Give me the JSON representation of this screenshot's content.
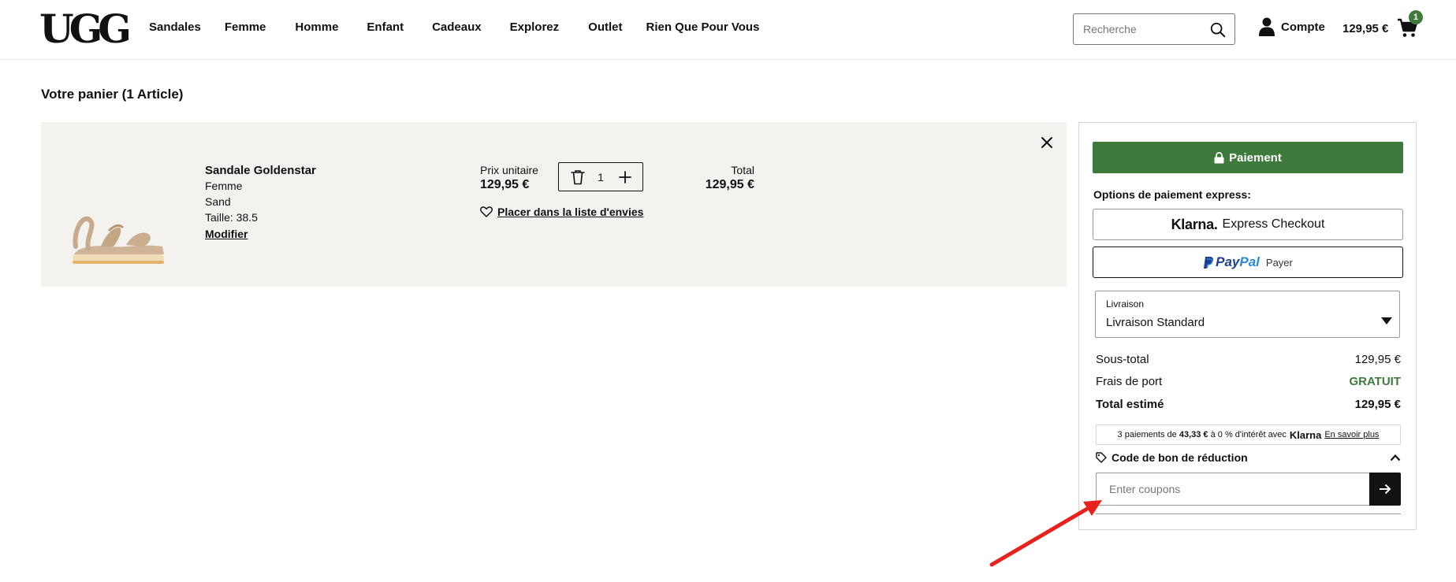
{
  "header": {
    "logo": "UGG",
    "nav": [
      "Sandales",
      "Femme",
      "Homme",
      "Enfant",
      "Cadeaux",
      "Explorez",
      "Outlet",
      "Rien Que Pour Vous"
    ],
    "search_placeholder": "Recherche",
    "account_label": "Compte",
    "cart_total": "129,95 €",
    "cart_count": "1"
  },
  "page": {
    "title": "Votre panier (1 Article)"
  },
  "cart_item": {
    "name": "Sandale Goldenstar",
    "gender": "Femme",
    "color": "Sand",
    "size": "Taille: 38.5",
    "modify_label": "Modifier",
    "unit_price_label": "Prix unitaire",
    "unit_price": "129,95 €",
    "quantity": "1",
    "total_label": "Total",
    "total_price": "129,95 €",
    "wishlist_label": "Placer dans la liste d'envies"
  },
  "summary": {
    "checkout_label": "Paiement",
    "express_label": "Options de paiement express:",
    "klarna_logo": "Klarna.",
    "klarna_text": "Express Checkout",
    "paypal_logo_1": "Pay",
    "paypal_logo_2": "Pal",
    "paypal_text": "Payer",
    "delivery_label": "Livraison",
    "delivery_value": "Livraison Standard",
    "subtotal_label": "Sous-total",
    "subtotal_value": "129,95 €",
    "shipping_label": "Frais de port",
    "shipping_value": "GRATUIT",
    "estimated_label": "Total estimé",
    "estimated_value": "129,95 €",
    "klarna_banner": {
      "prefix": "3 paiements de",
      "amount": "43,33 €",
      "middle": "à 0 % d'intérêt avec",
      "brand": "Klarna",
      "link": "En savoir plus"
    },
    "coupon_title": "Code de bon de réduction",
    "coupon_placeholder": "Enter coupons"
  },
  "colors": {
    "accent_green": "#3f7a3d",
    "panel_bg": "#f3f2ee",
    "annotation_arrow": "#e8211d"
  }
}
